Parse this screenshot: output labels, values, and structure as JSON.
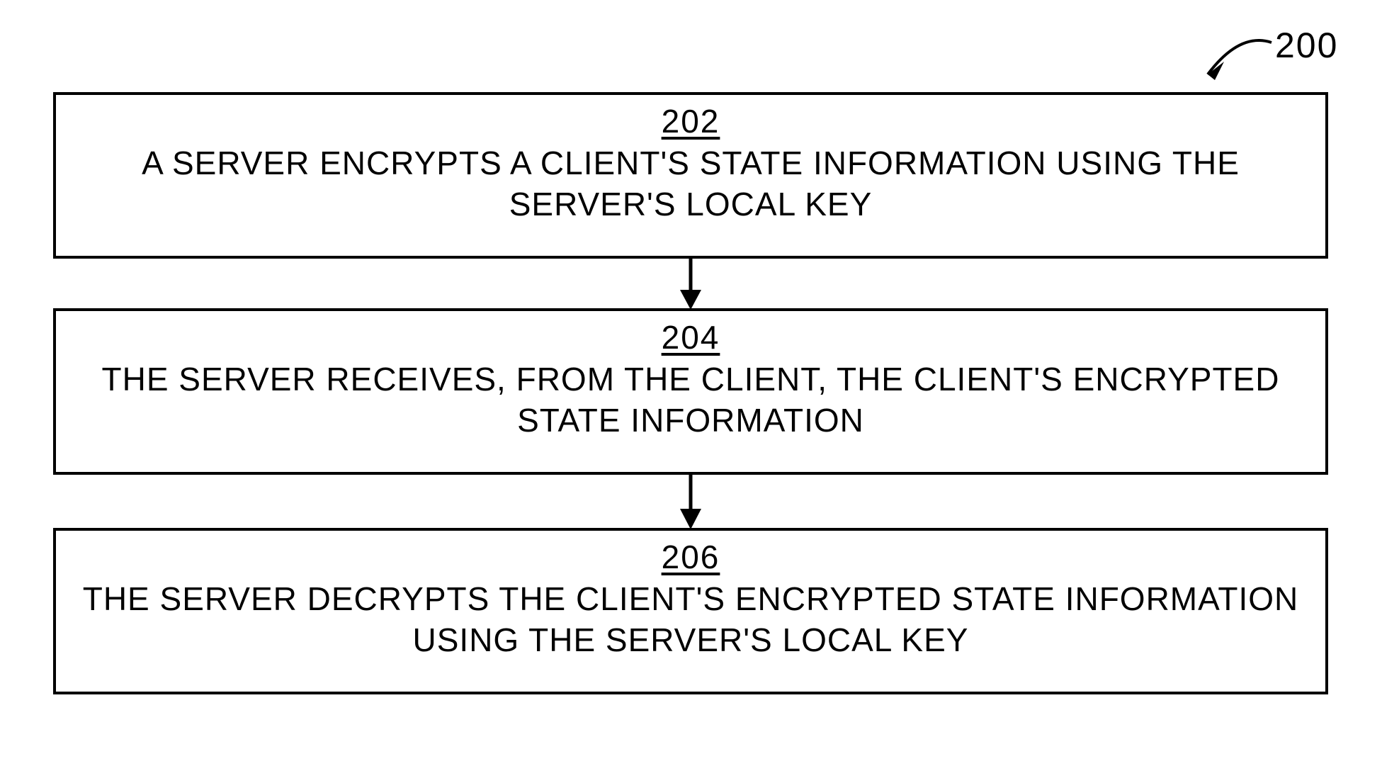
{
  "figure": {
    "label": "200",
    "steps": [
      {
        "num": "202",
        "text": "A SERVER ENCRYPTS A CLIENT'S STATE INFORMATION USING THE SERVER'S LOCAL KEY"
      },
      {
        "num": "204",
        "text": "THE SERVER RECEIVES, FROM THE CLIENT, THE CLIENT'S ENCRYPTED STATE INFORMATION"
      },
      {
        "num": "206",
        "text": "THE SERVER DECRYPTS THE CLIENT'S ENCRYPTED STATE INFORMATION USING THE SERVER'S LOCAL KEY"
      }
    ]
  }
}
